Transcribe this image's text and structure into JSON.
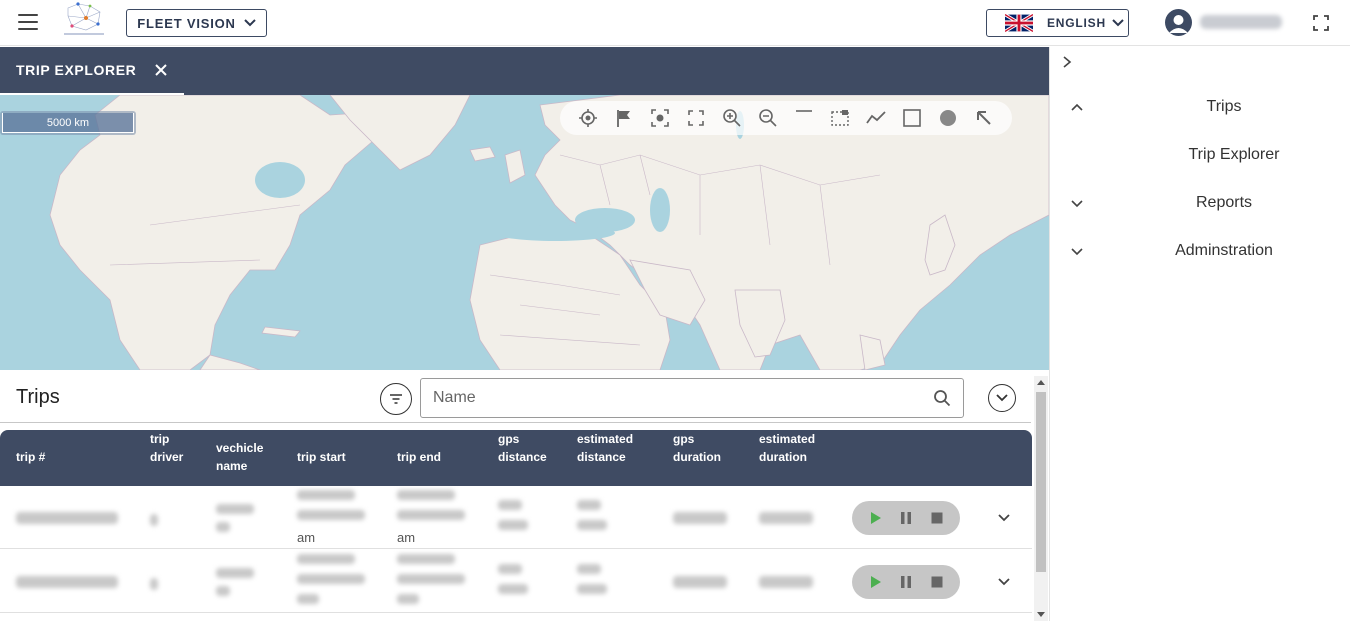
{
  "header": {
    "app_selector_label": "FLEET VISION",
    "language_label": "ENGLISH"
  },
  "tabs": [
    {
      "label": "TRIP EXPLORER"
    }
  ],
  "map": {
    "scale_label": "5000 km",
    "tools": [
      "locate-icon",
      "flag-icon",
      "focus-icon",
      "fit-extent-icon",
      "zoom-in-icon",
      "zoom-out-icon",
      "line-icon",
      "box-select-icon",
      "polyline-icon",
      "square-icon",
      "circle-icon",
      "pointer-icon"
    ]
  },
  "sidebar": {
    "items": [
      {
        "label": "Trips",
        "expanded": true
      },
      {
        "label": "Trip Explorer",
        "sub": true
      },
      {
        "label": "Reports",
        "expanded": false
      },
      {
        "label": "Adminstration",
        "expanded": false
      }
    ]
  },
  "trips": {
    "title": "Trips",
    "search_placeholder": "Name",
    "columns": [
      {
        "key": "trip_no",
        "label": "trip #"
      },
      {
        "key": "trip_driver",
        "label": "trip driver"
      },
      {
        "key": "vehicle_name",
        "label": "vechicle name"
      },
      {
        "key": "trip_start",
        "label": "trip start"
      },
      {
        "key": "trip_end",
        "label": "trip end"
      },
      {
        "key": "gps_distance",
        "label": "gps distance"
      },
      {
        "key": "estimated_distance",
        "label": "estimated distance"
      },
      {
        "key": "gps_duration",
        "label": "gps duration"
      },
      {
        "key": "estimated_duration",
        "label": "estimated duration"
      }
    ],
    "rows": [
      {
        "trip_start_suffix": "am",
        "trip_end_suffix": "am"
      },
      {
        "trip_start_suffix": "",
        "trip_end_suffix": ""
      }
    ]
  },
  "colors": {
    "header_navy": "#3f4b63",
    "map_water": "#aad3df",
    "map_land": "#f2efe9",
    "play_green": "#4caf50"
  }
}
